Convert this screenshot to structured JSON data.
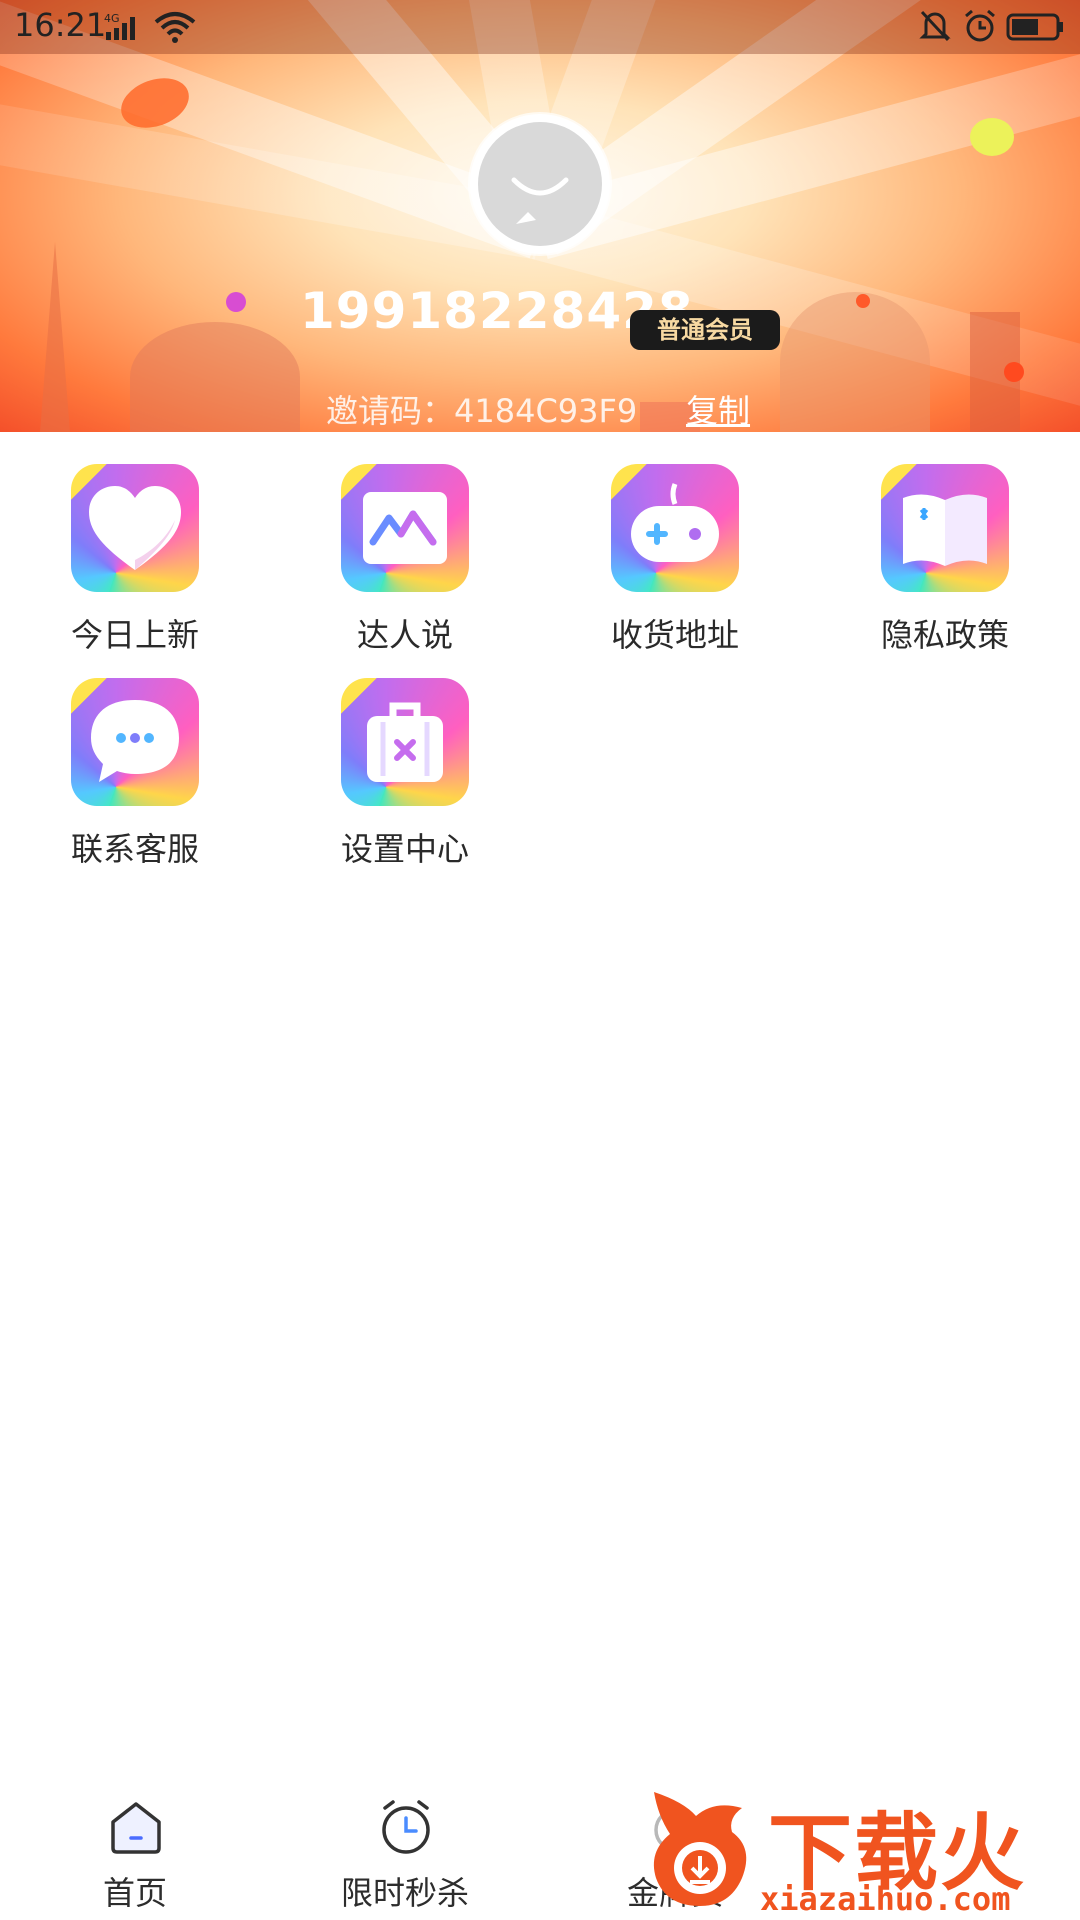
{
  "status_bar": {
    "time": "16:21",
    "network": "4G"
  },
  "profile": {
    "phone": "19918228428",
    "member_level": "普通会员",
    "invite_label": "邀请码：",
    "invite_code": "4184C93F9",
    "copy_label": "复制"
  },
  "menu": [
    {
      "label": "今日上新",
      "icon": "heart-icon"
    },
    {
      "label": "达人说",
      "icon": "photo-icon"
    },
    {
      "label": "收货地址",
      "icon": "gamepad-icon"
    },
    {
      "label": "隐私政策",
      "icon": "book-icon"
    },
    {
      "label": "联系客服",
      "icon": "chat-bubble-icon"
    },
    {
      "label": "设置中心",
      "icon": "suitcase-icon"
    }
  ],
  "bottom_nav": [
    {
      "label": "首页",
      "icon": "home-icon"
    },
    {
      "label": "限时秒杀",
      "icon": "alarm-clock-icon"
    },
    {
      "label": "金牌卖",
      "icon": "medal-icon"
    }
  ],
  "watermark": {
    "title": "下载火",
    "url": "xiazaihuo.com"
  },
  "colors": {
    "badge_bg": "#1b1b1b",
    "badge_text": "#f7d9a2",
    "watermark": "#f0541f",
    "header_warm": "#ff7a3d"
  }
}
